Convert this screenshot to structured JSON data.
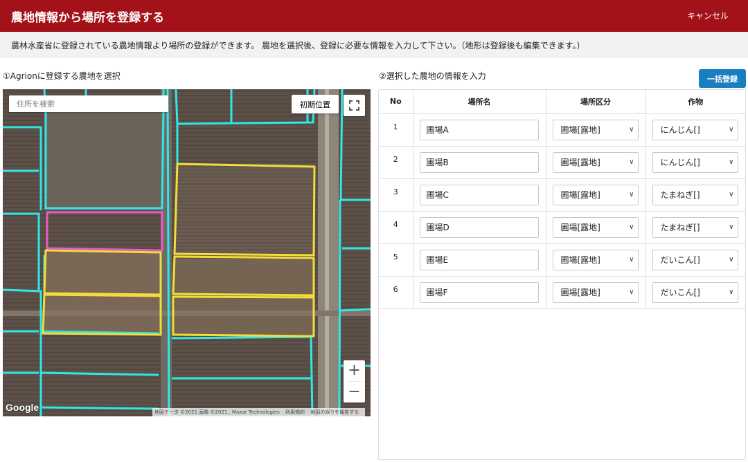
{
  "header": {
    "title": "農地情報から場所を登録する",
    "cancel_label": "キャンセル"
  },
  "notice": "農林水産省に登録されている農地情報より場所の登録ができます。 農地を選択後、登録に必要な情報を入力して下さい。（地形は登録後も編集できます。）",
  "left_section": {
    "title": "①Agrionに登録する農地を選択",
    "search_placeholder": "住所を検索",
    "init_position_label": "初期位置",
    "zoom_in": "+",
    "zoom_out": "−",
    "google_logo": "Google",
    "attribution": [
      "地図データ ©2021 画像 ©2021 , Maxar Technologies",
      "利用規約",
      "地図の誤りを報告する"
    ],
    "colors": {
      "field_boundary": "#2ee8e8",
      "selected": "#f2dd3a",
      "highlight": "#e85cc6"
    }
  },
  "right_section": {
    "title": "②選択した農地の情報を入力",
    "bulk_register_label": "一括登録",
    "columns": [
      "No",
      "場所名",
      "場所区分",
      "作物"
    ],
    "rows": [
      {
        "no": "1",
        "name": "圃場A",
        "kubun": "圃場[露地]",
        "crop": "にんじん[]"
      },
      {
        "no": "2",
        "name": "圃場B",
        "kubun": "圃場[露地]",
        "crop": "にんじん[]"
      },
      {
        "no": "3",
        "name": "圃場C",
        "kubun": "圃場[露地]",
        "crop": "たまねぎ[]"
      },
      {
        "no": "4",
        "name": "圃場D",
        "kubun": "圃場[露地]",
        "crop": "たまねぎ[]"
      },
      {
        "no": "5",
        "name": "圃場E",
        "kubun": "圃場[露地]",
        "crop": "だいこん[]"
      },
      {
        "no": "6",
        "name": "圃場F",
        "kubun": "圃場[露地]",
        "crop": "だいこん[]"
      }
    ]
  },
  "accent_colors": {
    "header_bg": "#a31119",
    "button_blue": "#1a7fc1"
  }
}
